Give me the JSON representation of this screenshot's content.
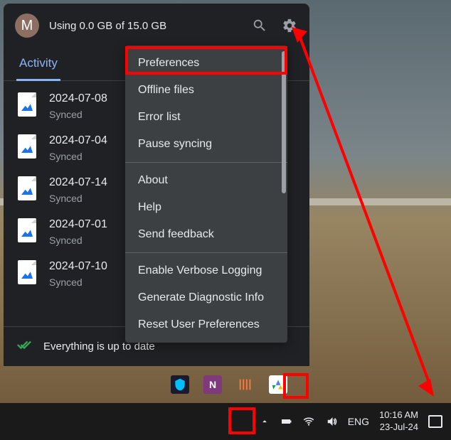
{
  "header": {
    "avatar_initial": "M",
    "storage_text": "Using 0.0 GB of 15.0 GB"
  },
  "tabs": {
    "active": "Activity"
  },
  "files": [
    {
      "date": "2024-07-08",
      "status": "Synced"
    },
    {
      "date": "2024-07-04",
      "status": "Synced"
    },
    {
      "date": "2024-07-14",
      "status": "Synced"
    },
    {
      "date": "2024-07-01",
      "status": "Synced"
    },
    {
      "date": "2024-07-10",
      "status": "Synced"
    }
  ],
  "status_bar": {
    "text": "Everything is up to date"
  },
  "dropdown": {
    "group1": [
      {
        "label": "Preferences"
      },
      {
        "label": "Offline files"
      },
      {
        "label": "Error list"
      },
      {
        "label": "Pause syncing"
      }
    ],
    "group2": [
      {
        "label": "About"
      },
      {
        "label": "Help"
      },
      {
        "label": "Send feedback"
      }
    ],
    "group3": [
      {
        "label": "Enable Verbose Logging"
      },
      {
        "label": "Generate Diagnostic Info"
      },
      {
        "label": "Reset User Preferences"
      }
    ]
  },
  "systray": {
    "language": "ENG",
    "time": "10:16 AM",
    "date": "23-Jul-24"
  }
}
